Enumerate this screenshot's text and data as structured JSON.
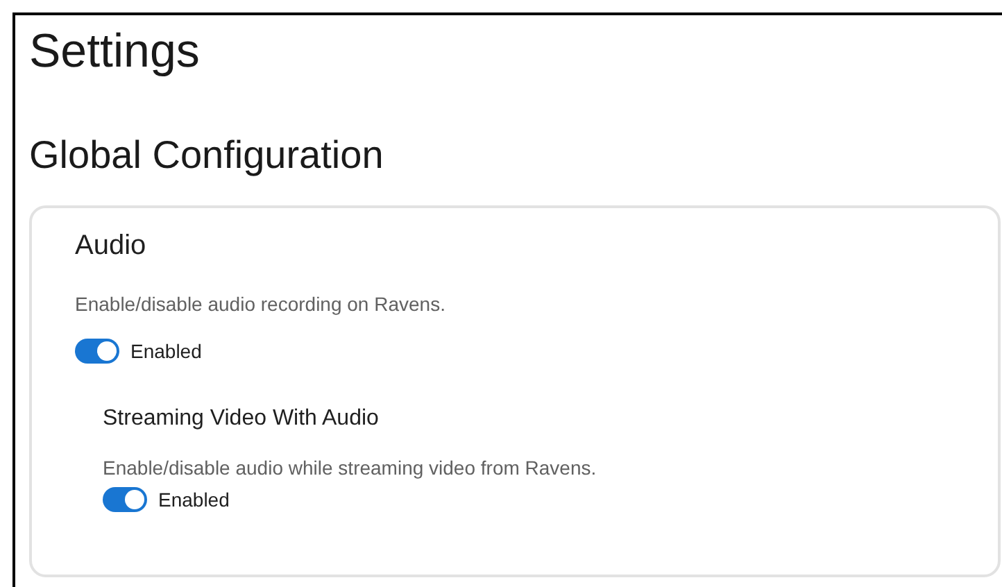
{
  "title": "Settings",
  "section": {
    "title": "Global Configuration",
    "card": {
      "title": "Audio",
      "description": "Enable/disable audio recording on Ravens.",
      "toggle": {
        "label": "Enabled",
        "on": true
      },
      "subsections": [
        {
          "title": "Streaming Video With Audio",
          "description": "Enable/disable audio while streaming video from Ravens.",
          "toggle": {
            "label": "Enabled",
            "on": true
          }
        }
      ]
    }
  }
}
